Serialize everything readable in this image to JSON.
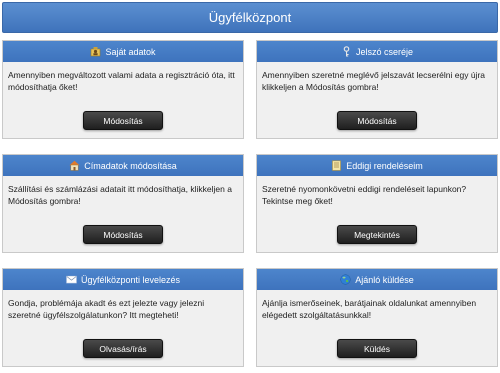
{
  "header": {
    "title": "Ügyfélközpont"
  },
  "cards": [
    {
      "title": "Saját adatok",
      "icon": "user-icon",
      "text": "Amennyiben megváltozott valami adata a regisztráció óta, itt módosíthatja őket!",
      "button": "Módosítás"
    },
    {
      "title": "Jelszó cseréje",
      "icon": "key-icon",
      "text": "Amennyiben szeretné meglévő jelszavát lecserélni egy újra klikkeljen a Módosítás gombra!",
      "button": "Módosítás"
    },
    {
      "title": "Címadatok módosítása",
      "icon": "home-icon",
      "text": "Szállítási és számlázási adatait itt módosíthatja, klikkeljen a Módosítás gombra!",
      "button": "Módosítás"
    },
    {
      "title": "Eddigi rendeléseim",
      "icon": "document-icon",
      "text": "Szeretné nyomonkövetni eddigi rendeléseit lapunkon? Tekintse meg őket!",
      "button": "Megtekintés"
    },
    {
      "title": "Ügyfélközponti levelezés",
      "icon": "envelope-icon",
      "text": "Gondja, problémája akadt és ezt jelezte vagy jelezni szeretné ügyfélszolgálatunkon? Itt megteheti!",
      "button": "Olvasás/írás"
    },
    {
      "title": "Ajánló küldése",
      "icon": "globe-icon",
      "text": "Ajánlja ismerőseinek, barátjainak oldalunkat amennyiben elégedett szolgáltatásunkkal!",
      "button": "Küldés"
    }
  ]
}
